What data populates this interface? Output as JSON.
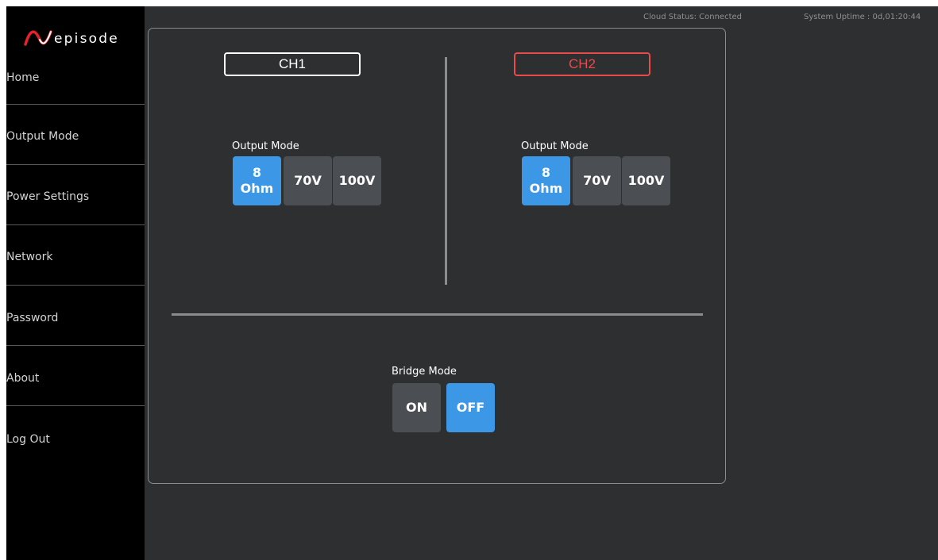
{
  "brand": {
    "logo_text": "episode"
  },
  "status": {
    "cloud": "Cloud Status: Connected",
    "uptime": "System Uptime : 0d,01:20:44"
  },
  "nav": {
    "items": [
      {
        "label": "Home"
      },
      {
        "label": "Output Mode"
      },
      {
        "label": "Power Settings"
      },
      {
        "label": "Network"
      },
      {
        "label": "Password"
      },
      {
        "label": "About"
      },
      {
        "label": "Log Out"
      }
    ]
  },
  "channels": [
    {
      "name": "CH1",
      "color": "#ffffff",
      "output_mode_label": "Output Mode",
      "options": [
        {
          "line1": "8",
          "line2": "Ohm",
          "selected": true
        },
        {
          "label": "70V",
          "selected": false
        },
        {
          "label": "100V",
          "selected": false
        }
      ]
    },
    {
      "name": "CH2",
      "color": "#e94b4b",
      "output_mode_label": "Output Mode",
      "options": [
        {
          "line1": "8",
          "line2": "Ohm",
          "selected": true
        },
        {
          "label": "70V",
          "selected": false
        },
        {
          "label": "100V",
          "selected": false
        }
      ]
    }
  ],
  "bridge": {
    "label": "Bridge Mode",
    "on_label": "ON",
    "off_label": "OFF",
    "selected": "OFF"
  },
  "colors": {
    "accent": "#3c97e6",
    "ch2": "#e94b4b",
    "background": "#2d2f31"
  }
}
